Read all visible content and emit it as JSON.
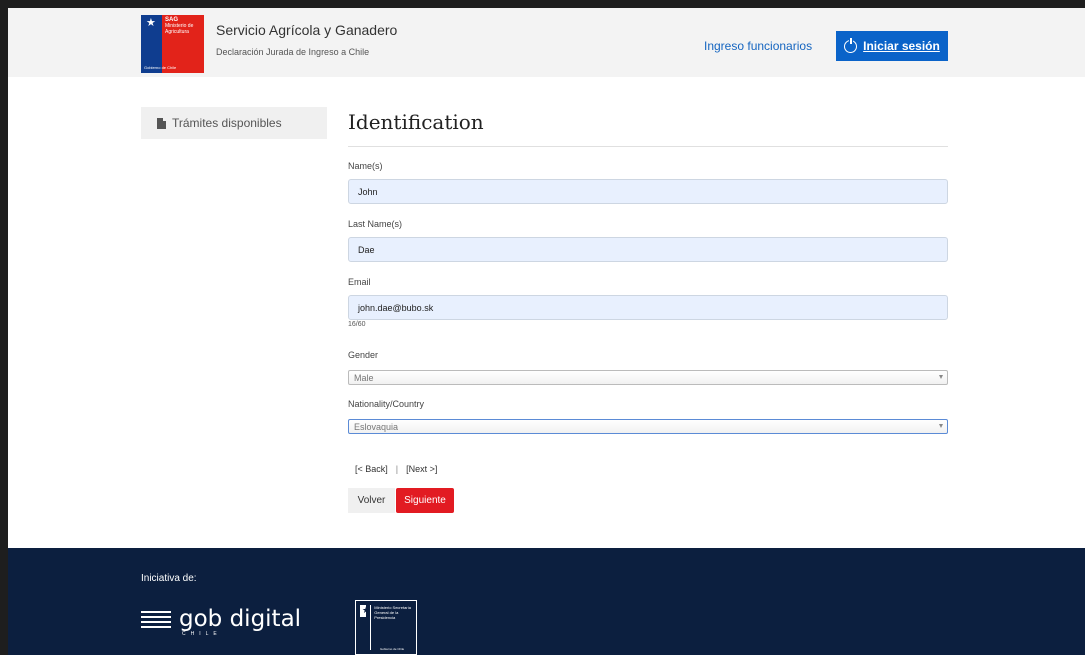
{
  "header": {
    "logo_text": "SAG",
    "logo_subtext": "Ministerio de Agricultura",
    "logo_caption": "Gobierno de Chile",
    "title": "Servicio Agrícola y Ganadero",
    "subtitle": "Declaración Jurada de Ingreso a Chile",
    "staff_link": "Ingreso funcionarios",
    "login_button": "Iniciar sesión",
    "login_icon": "power-icon",
    "colors": {
      "header_bg": "#f3f3f3",
      "login_bg": "#0a63c9",
      "link": "#1565c0"
    }
  },
  "sidebar": {
    "items": [
      {
        "label": "Trámites disponibles",
        "icon": "document-icon"
      }
    ]
  },
  "form": {
    "title": "Identification",
    "fields": [
      {
        "label": "Name(s)",
        "value": "John"
      },
      {
        "label": "Last Name(s)",
        "value": "Dae"
      },
      {
        "label": "Email",
        "value": "john.dae@bubo.sk",
        "counter": "16/60"
      }
    ],
    "selects": [
      {
        "label": "Gender",
        "value": "Male"
      },
      {
        "label": "Nationality/Country",
        "value": "Eslovaquia"
      }
    ],
    "nav": {
      "back": "[< Back]",
      "separator": "|",
      "next": "[Next >]"
    },
    "buttons": {
      "back": "Volver",
      "next": "Siguiente"
    },
    "colors": {
      "input_bg": "#e8f0fe",
      "next_bg": "#e21b22"
    }
  },
  "footer": {
    "initiative_label": "Iniciativa de:",
    "gob_digital": "gob digital",
    "gob_digital_sub": "CHILE",
    "ministry_text": "Ministerio Secretaría General de la Presidencia",
    "ministry_caption": "Gobierno de Chile",
    "colors": {
      "footer_bg": "#0c1f3f"
    }
  }
}
